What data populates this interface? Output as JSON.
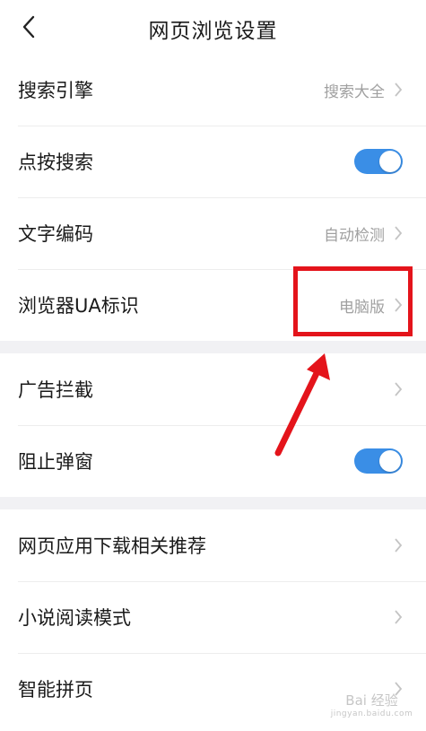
{
  "header": {
    "title": "网页浏览设置"
  },
  "groups": [
    {
      "items": [
        {
          "label": "搜索引擎",
          "value": "搜索大全"
        },
        {
          "label": "点按搜索",
          "toggle": true
        },
        {
          "label": "文字编码",
          "value": "自动检测"
        },
        {
          "label": "浏览器UA标识",
          "value": "电脑版"
        }
      ]
    },
    {
      "items": [
        {
          "label": "广告拦截"
        },
        {
          "label": "阻止弹窗",
          "toggle": true
        }
      ]
    },
    {
      "items": [
        {
          "label": "网页应用下载相关推荐"
        },
        {
          "label": "小说阅读模式"
        },
        {
          "label": "智能拼页"
        }
      ]
    }
  ],
  "watermark": {
    "main": "Bai 经验",
    "sub": "jingyan.baidu.com"
  },
  "colors": {
    "toggle_on": "#3a8ee6",
    "annotation": "#e4141b",
    "separator": "#f1f1f4"
  }
}
